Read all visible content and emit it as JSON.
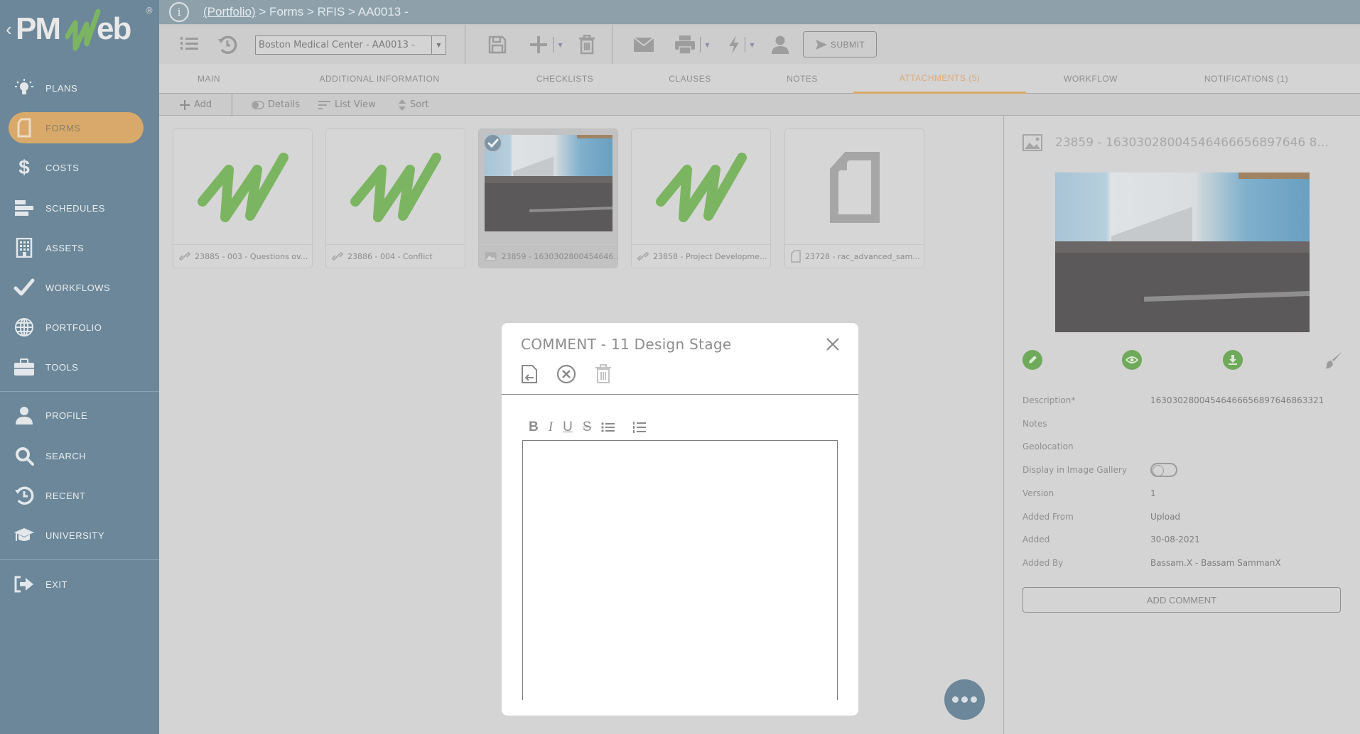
{
  "app": {
    "logo_text_left": "PM",
    "logo_text_right": "eb",
    "logo_back": "‹",
    "logo_registered": "®"
  },
  "colors": {
    "sidebar": "#6b8799",
    "accent": "#d8a96a",
    "header": "#8ea1ab",
    "action_green": "#6fa95a"
  },
  "sidebar": {
    "items": [
      {
        "label": "PLANS",
        "icon": "lightbulb-icon"
      },
      {
        "label": "FORMS",
        "icon": "document-icon",
        "active": true
      },
      {
        "label": "COSTS",
        "icon": "dollar-icon"
      },
      {
        "label": "SCHEDULES",
        "icon": "gantt-icon"
      },
      {
        "label": "ASSETS",
        "icon": "building-icon"
      },
      {
        "label": "WORKFLOWS",
        "icon": "checkmark-icon"
      },
      {
        "label": "PORTFOLIO",
        "icon": "globe-icon"
      },
      {
        "label": "TOOLS",
        "icon": "toolbox-icon"
      },
      {
        "label": "PROFILE",
        "icon": "user-icon"
      },
      {
        "label": "SEARCH",
        "icon": "search-icon"
      },
      {
        "label": "RECENT",
        "icon": "history-icon"
      },
      {
        "label": "UNIVERSITY",
        "icon": "graduation-cap-icon"
      },
      {
        "label": "EXIT",
        "icon": "exit-icon"
      }
    ]
  },
  "header": {
    "breadcrumb_link": "(Portfolio)",
    "breadcrumb_rest": " > Forms > RFIS > AA0013 -"
  },
  "toolbar": {
    "project_select": "Boston Medical Center - AA0013 -",
    "submit_label": "SUBMIT"
  },
  "tabs": [
    {
      "label": "MAIN"
    },
    {
      "label": "ADDITIONAL INFORMATION"
    },
    {
      "label": "CHECKLISTS"
    },
    {
      "label": "CLAUSES"
    },
    {
      "label": "NOTES"
    },
    {
      "label": "ATTACHMENTS (5)",
      "active": true
    },
    {
      "label": "WORKFLOW"
    },
    {
      "label": "NOTIFICATIONS (1)"
    }
  ],
  "actionbar": {
    "add": "Add",
    "details": "Details",
    "list_view": "List View",
    "sort": "Sort"
  },
  "attachments": [
    {
      "caption": "23885 - 003 - Questions ov...",
      "type": "link",
      "thumb": "pmweb-logo"
    },
    {
      "caption": "23886 - 004 - Conflict",
      "type": "link",
      "thumb": "pmweb-logo"
    },
    {
      "caption": "23859 - 1630302800454646...",
      "type": "image",
      "thumb": "photo",
      "selected": true
    },
    {
      "caption": "23858 - Project Developme...",
      "type": "link",
      "thumb": "pmweb-logo"
    },
    {
      "caption": "23728 - rac_advanced_sam...",
      "type": "file",
      "thumb": "file"
    }
  ],
  "detail": {
    "title": "23859 - 16303028004546466656897646 8...",
    "fields": [
      {
        "label": "Description*",
        "value": "16303028004546466656897646863321"
      },
      {
        "label": "Notes",
        "value": ""
      },
      {
        "label": "Geolocation",
        "value": ""
      },
      {
        "label": "Display in Image Gallery",
        "value": "",
        "toggle": false
      },
      {
        "label": "Version",
        "value": "1"
      },
      {
        "label": "Added From",
        "value": "Upload"
      },
      {
        "label": "Added",
        "value": "30-08-2021"
      },
      {
        "label": "Added By",
        "value": "Bassam.X - Bassam SammanX"
      }
    ],
    "add_comment": "ADD COMMENT"
  },
  "modal": {
    "title": "COMMENT - 11 Design Stage",
    "editor_value": "",
    "rte": {
      "bold": "B",
      "italic": "I",
      "underline": "U",
      "strike": "S"
    }
  }
}
